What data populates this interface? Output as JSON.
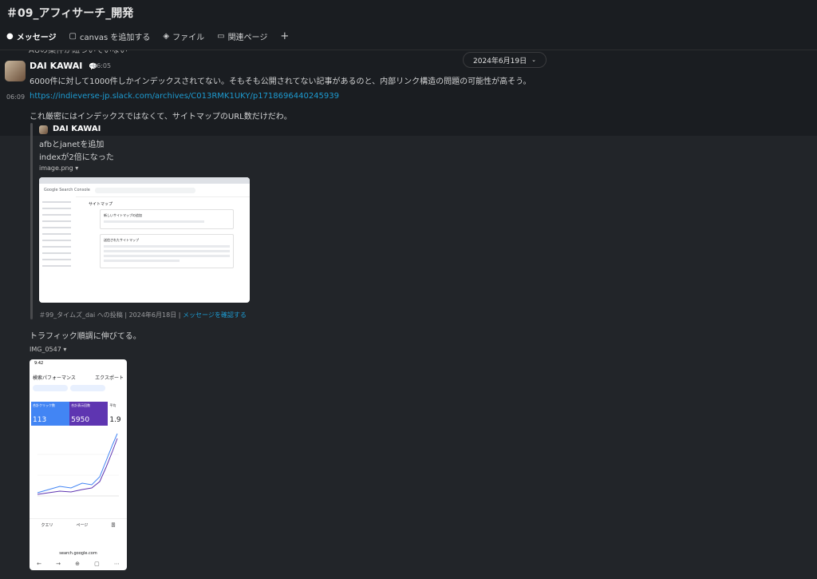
{
  "header": {
    "channel_title": "＃09_アフィサーチ_開発",
    "tabs": [
      {
        "label": "メッセージ",
        "icon": "message-icon"
      },
      {
        "label": "canvas を追加する",
        "icon": "canvas-icon"
      },
      {
        "label": "ファイル",
        "icon": "files-icon"
      },
      {
        "label": "関連ページ",
        "icon": "folder-icon"
      }
    ],
    "add_label": "+"
  },
  "previous_message_fragment": "AUの案件が紐づいていない",
  "date_divider": "2024年6月19日",
  "message": {
    "author": "DAI KAWAI",
    "time": "06:05",
    "text": "6000件に対して1000件しかインデックスされてない。そもそも公開されてない記事があるのと、内部リンク構造の問題の可能性が高そう。"
  },
  "followup": {
    "time": "06:09",
    "link": "https://indieverse-jp.slack.com/archives/C013RMK1UKY/p1718696440245939",
    "text": "これ厳密にはインデックスではなくて、サイトマップのURL数だけだわ。",
    "quote": {
      "author": "DAI KAWAI",
      "line1": "afbとjanetを追加",
      "line2": "indexが2倍になった",
      "file_name": "image.png",
      "footer_channel": "＃99_タイムズ_dai への投稿",
      "footer_date": "2024年6月18日",
      "footer_link": "メッセージを確認する"
    }
  },
  "second": {
    "text": "トラフィック順調に伸びてる。",
    "file_name": "IMG_0547"
  },
  "thumb1": {
    "app": "Google Search Console",
    "page": "サイトマップ",
    "card1": "新しいサイトマップの追加",
    "card2": "送信されたサイトマップ"
  },
  "thumb2": {
    "time": "9:42",
    "title": "検索パフォーマンス",
    "export": "エクスポート",
    "kpis": [
      {
        "label": "合計クリック数",
        "value": "113",
        "color": "#4285f4"
      },
      {
        "label": "合計表示回数",
        "value": "5950",
        "color": "#5e35b1"
      },
      {
        "label": "平均",
        "value": "1.9",
        "color": "#ffffff"
      }
    ],
    "tabs": [
      "クエリ",
      "ページ",
      "国"
    ],
    "url": "search.google.com"
  }
}
